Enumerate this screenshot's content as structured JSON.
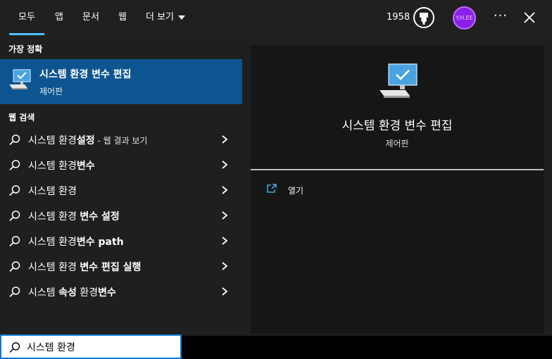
{
  "tabs": [
    {
      "label": "모두",
      "active": true
    },
    {
      "label": "앱"
    },
    {
      "label": "문서"
    },
    {
      "label": "웹"
    },
    {
      "label": "더 보기"
    }
  ],
  "header": {
    "points": "1958",
    "avatar_text": "Y.H.EE"
  },
  "best_match": {
    "section_label": "가장 정확",
    "title": "시스템 환경 변수 편집",
    "subtitle": "제어판"
  },
  "web_search": {
    "section_label": "웹 검색",
    "items": [
      {
        "normal": "시스템 환경",
        "bold": "설정",
        "hint": " - 웹 결과 보기"
      },
      {
        "normal": "시스템 환경",
        "bold": "변수",
        "hint": ""
      },
      {
        "normal": "시스템 환경",
        "bold": "",
        "hint": ""
      },
      {
        "normal": "시스템 환경 ",
        "bold": "변수 설정",
        "hint": ""
      },
      {
        "normal": "시스템 환경",
        "bold": "변수 path",
        "hint": ""
      },
      {
        "normal": "시스템 환경 ",
        "bold": "변수 편집 실행",
        "hint": ""
      },
      {
        "normal": "시스템 ",
        "bold": "속성",
        "normal2": " 환경",
        "bold2": "변수",
        "hint": ""
      }
    ]
  },
  "preview": {
    "title": "시스템 환경 변수 편집",
    "subtitle": "제어판",
    "open_label": "열기"
  },
  "search": {
    "value": "시스템 환경"
  },
  "colors": {
    "accent": "#4cc2ff",
    "selected": "#0d5590",
    "avatar": "#8a1fe6"
  }
}
